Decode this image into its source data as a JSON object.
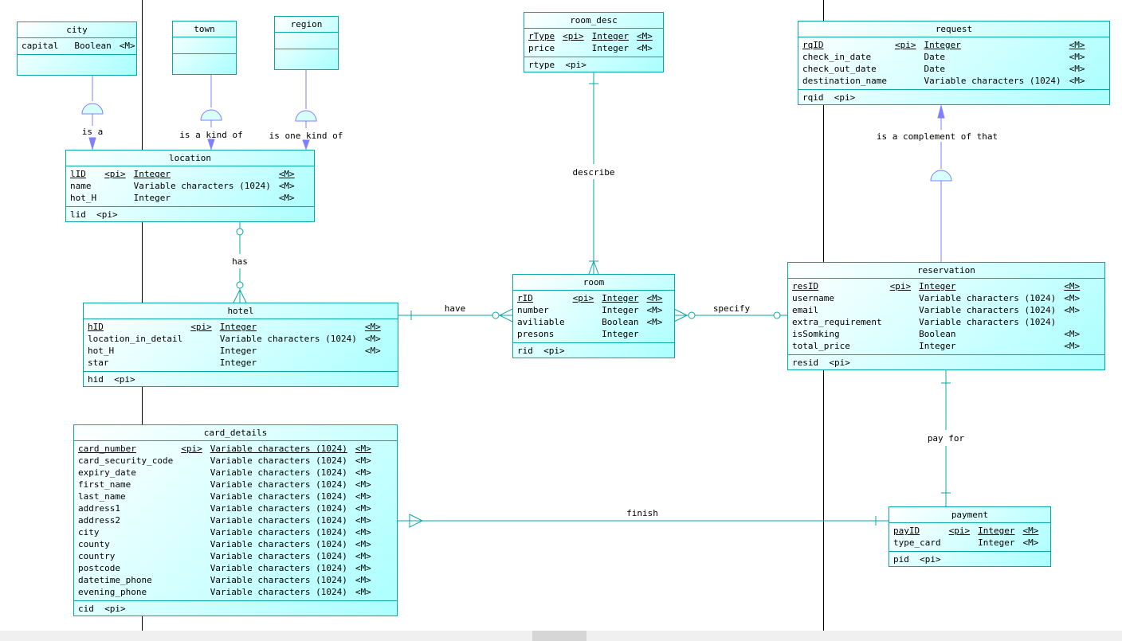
{
  "colors": {
    "entity_border": "#0aa6a6",
    "entity_fill_light": "#ffffff",
    "entity_fill_dark": "#aaffff",
    "inheritance_link": "#7f7fff",
    "relationship_link": "#0aa6a6"
  },
  "entities": {
    "city": {
      "title": "city",
      "attributes": [
        {
          "name": "capital",
          "pi": "",
          "type": "Boolean",
          "m": "<M>"
        }
      ],
      "identifiers": []
    },
    "town": {
      "title": "town",
      "attributes": [],
      "identifiers": []
    },
    "region": {
      "title": "region",
      "attributes": [],
      "identifiers": []
    },
    "location": {
      "title": "location",
      "attributes": [
        {
          "name": "lID",
          "pi": "<pi>",
          "type": "Integer",
          "m": "<M>"
        },
        {
          "name": "name",
          "pi": "",
          "type": "Variable characters (1024)",
          "m": "<M>"
        },
        {
          "name": "hot_H",
          "pi": "",
          "type": "Integer",
          "m": "<M>"
        }
      ],
      "identifiers": [
        "lid  <pi>"
      ]
    },
    "hotel": {
      "title": "hotel",
      "attributes": [
        {
          "name": "hID",
          "pi": "<pi>",
          "type": "Integer",
          "m": "<M>"
        },
        {
          "name": "location_in_detail",
          "pi": "",
          "type": "Variable characters (1024)",
          "m": "<M>"
        },
        {
          "name": "hot_H",
          "pi": "",
          "type": "Integer",
          "m": "<M>"
        },
        {
          "name": "star",
          "pi": "",
          "type": "Integer",
          "m": ""
        }
      ],
      "identifiers": [
        "hid  <pi>"
      ]
    },
    "card_details": {
      "title": "card_details",
      "attributes": [
        {
          "name": "card_number",
          "pi": "<pi>",
          "type": "Variable characters (1024)",
          "m": "<M>"
        },
        {
          "name": "card_security_code",
          "pi": "",
          "type": "Variable characters (1024)",
          "m": "<M>"
        },
        {
          "name": "expiry_date",
          "pi": "",
          "type": "Variable characters (1024)",
          "m": "<M>"
        },
        {
          "name": "first_name",
          "pi": "",
          "type": "Variable characters (1024)",
          "m": "<M>"
        },
        {
          "name": "last_name",
          "pi": "",
          "type": "Variable characters (1024)",
          "m": "<M>"
        },
        {
          "name": "address1",
          "pi": "",
          "type": "Variable characters (1024)",
          "m": "<M>"
        },
        {
          "name": "address2",
          "pi": "",
          "type": "Variable characters (1024)",
          "m": "<M>"
        },
        {
          "name": "city",
          "pi": "",
          "type": "Variable characters (1024)",
          "m": "<M>"
        },
        {
          "name": "county",
          "pi": "",
          "type": "Variable characters (1024)",
          "m": "<M>"
        },
        {
          "name": "country",
          "pi": "",
          "type": "Variable characters (1024)",
          "m": "<M>"
        },
        {
          "name": "postcode",
          "pi": "",
          "type": "Variable characters (1024)",
          "m": "<M>"
        },
        {
          "name": "datetime_phone",
          "pi": "",
          "type": "Variable characters (1024)",
          "m": "<M>"
        },
        {
          "name": "evening_phone",
          "pi": "",
          "type": "Variable characters (1024)",
          "m": "<M>"
        }
      ],
      "identifiers": [
        "cid  <pi>"
      ]
    },
    "room_desc": {
      "title": "room_desc",
      "attributes": [
        {
          "name": "rType",
          "pi": "<pi>",
          "type": "Integer",
          "m": "<M>"
        },
        {
          "name": "price",
          "pi": "",
          "type": "Integer",
          "m": "<M>"
        }
      ],
      "identifiers": [
        "rtype  <pi>"
      ]
    },
    "room": {
      "title": "room",
      "attributes": [
        {
          "name": "rID",
          "pi": "<pi>",
          "type": "Integer",
          "m": "<M>"
        },
        {
          "name": "number",
          "pi": "",
          "type": "Integer",
          "m": "<M>"
        },
        {
          "name": "aviliable",
          "pi": "",
          "type": "Boolean",
          "m": "<M>"
        },
        {
          "name": "presons",
          "pi": "",
          "type": "Integer",
          "m": ""
        }
      ],
      "identifiers": [
        "rid  <pi>"
      ]
    },
    "request": {
      "title": "request",
      "attributes": [
        {
          "name": "rqID",
          "pi": "<pi>",
          "type": "Integer",
          "m": "<M>"
        },
        {
          "name": "check_in_date",
          "pi": "",
          "type": "Date",
          "m": "<M>"
        },
        {
          "name": "check_out_date",
          "pi": "",
          "type": "Date",
          "m": "<M>"
        },
        {
          "name": "destination_name",
          "pi": "",
          "type": "Variable characters (1024)",
          "m": "<M>"
        }
      ],
      "identifiers": [
        "rqid  <pi>"
      ]
    },
    "reservation": {
      "title": "reservation",
      "attributes": [
        {
          "name": "resID",
          "pi": "<pi>",
          "type": "Integer",
          "m": "<M>"
        },
        {
          "name": "username",
          "pi": "",
          "type": "Variable characters (1024)",
          "m": "<M>"
        },
        {
          "name": "email",
          "pi": "",
          "type": "Variable characters (1024)",
          "m": "<M>"
        },
        {
          "name": "extra_requirement",
          "pi": "",
          "type": "Variable characters (1024)",
          "m": ""
        },
        {
          "name": "isSomking",
          "pi": "",
          "type": "Boolean",
          "m": "<M>"
        },
        {
          "name": "total_price",
          "pi": "",
          "type": "Integer",
          "m": "<M>"
        }
      ],
      "identifiers": [
        "resid  <pi>"
      ]
    },
    "payment": {
      "title": "payment",
      "attributes": [
        {
          "name": "payID",
          "pi": "<pi>",
          "type": "Integer",
          "m": "<M>"
        },
        {
          "name": "type_card",
          "pi": "",
          "type": "Integer",
          "m": "<M>"
        }
      ],
      "identifiers": [
        "pid  <pi>"
      ]
    }
  },
  "links": {
    "city_location": "is a",
    "town_location": "is a kind of",
    "region_location": "is one kind of",
    "location_hotel": "has",
    "hotel_room": "have",
    "room_reservation": "specify",
    "room_desc_room": "describe",
    "reservation_request": "is a complement of that",
    "reservation_payment": "pay for",
    "card_payment": "finish"
  }
}
